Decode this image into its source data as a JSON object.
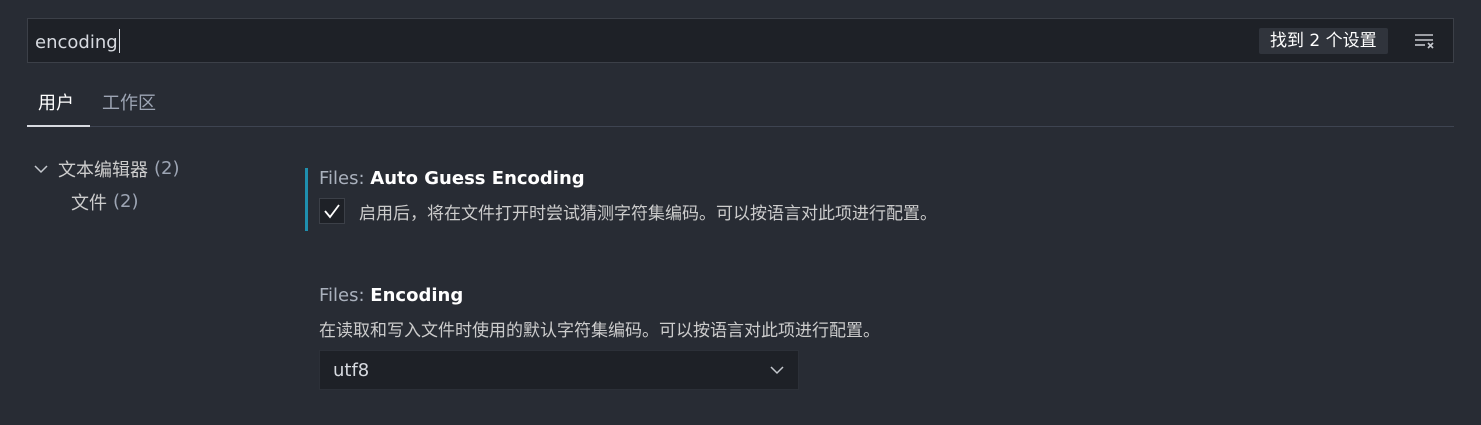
{
  "search": {
    "value": "encoding",
    "result_count": "找到 2 个设置"
  },
  "tabs": [
    {
      "label": "用户",
      "active": true
    },
    {
      "label": "工作区",
      "active": false
    }
  ],
  "toc": [
    {
      "label": "文本编辑器",
      "count": "(2)",
      "expanded": true
    },
    {
      "label": "文件",
      "count": "(2)"
    }
  ],
  "settings": [
    {
      "category": "Files: ",
      "name": "Auto Guess Encoding",
      "checked": true,
      "description": "启用后，将在文件打开时尝试猜测字符集编码。可以按语言对此项进行配置。"
    },
    {
      "category": "Files: ",
      "name": "Encoding",
      "description": "在读取和写入文件时使用的默认字符集编码。可以按语言对此项进行配置。",
      "value": "utf8"
    }
  ],
  "icons": {
    "clear": "clear-filter-icon",
    "chevron_expanded": "chevron-down-icon",
    "check": "check-icon",
    "select_arrow": "chevron-down-icon"
  },
  "colors": {
    "background": "#282c34",
    "input_background": "#1e2127",
    "modified_indicator": "#1f8fae"
  }
}
